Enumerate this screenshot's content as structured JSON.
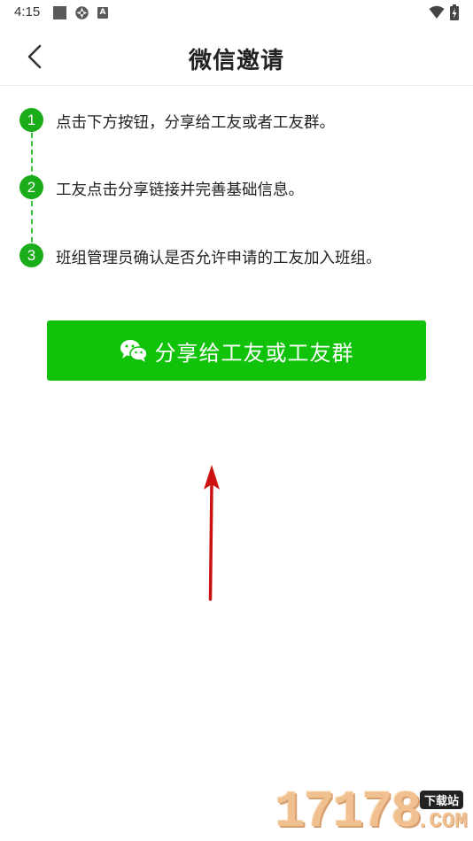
{
  "status_bar": {
    "time": "4:15",
    "icons": [
      "square-icon",
      "gear-icon",
      "a-icon",
      "wifi-icon",
      "battery-icon"
    ],
    "a_letter": "A"
  },
  "header": {
    "back_icon": "chevron-left-icon",
    "title": "微信邀请"
  },
  "steps": [
    {
      "number": "1",
      "text": "点击下方按钮，分享给工友或者工友群。"
    },
    {
      "number": "2",
      "text": "工友点击分享链接并完善基础信息。"
    },
    {
      "number": "3",
      "text": "班组管理员确认是否允许申请的工友加入班组。"
    }
  ],
  "share_button": {
    "icon": "wechat-icon",
    "label": "分享给工友或工友群"
  },
  "watermark": {
    "digits": "17178",
    "tag": "下载站",
    "domain": ".COM"
  },
  "colors": {
    "accent_green": "#10c20a",
    "step_green": "#1aad19",
    "arrow_red": "#cc1111"
  }
}
